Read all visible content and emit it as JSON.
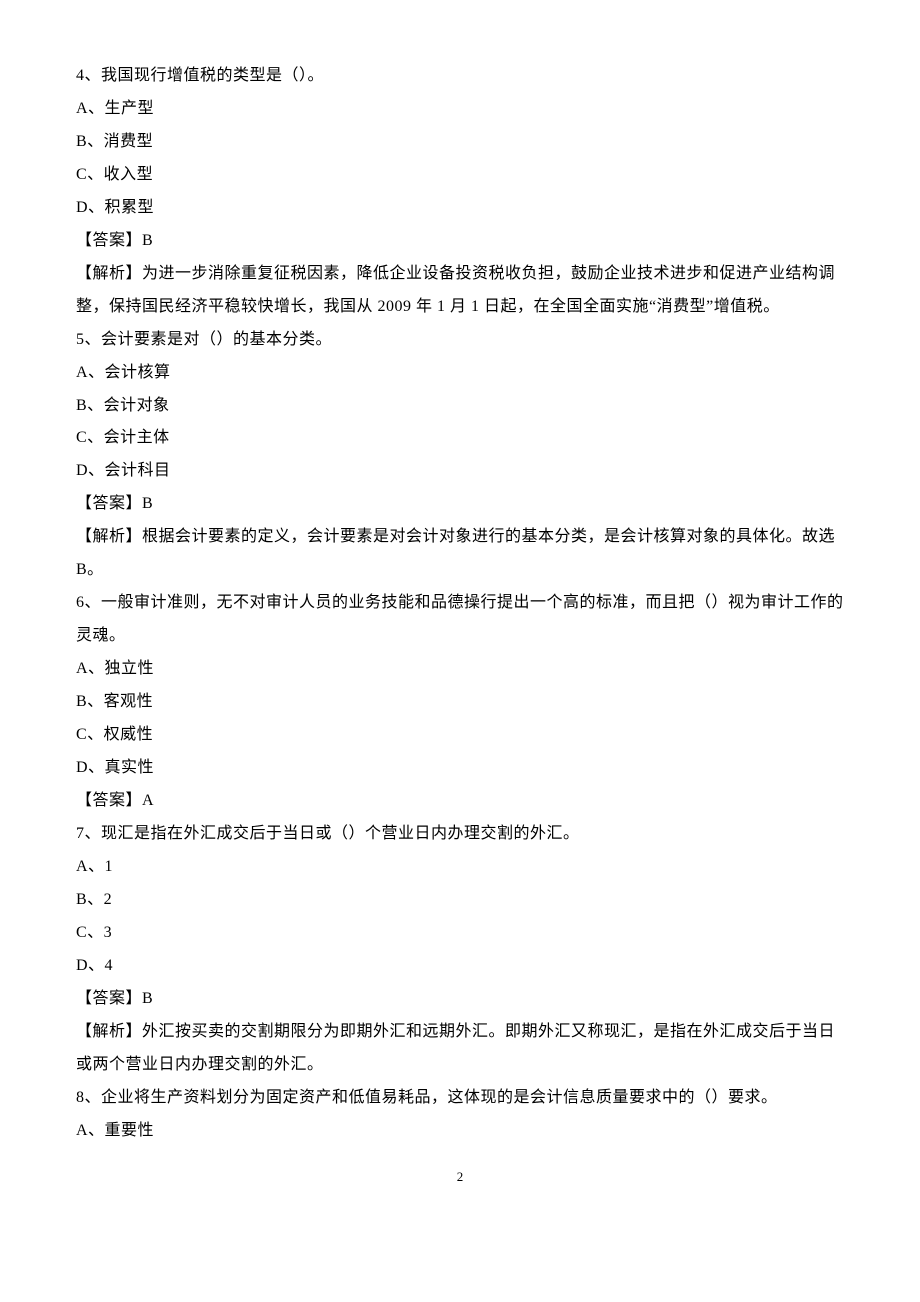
{
  "q4": {
    "stem": "4、我国现行增值税的类型是（）。",
    "a": "A、生产型",
    "b": "B、消费型",
    "c": "C、收入型",
    "d": "D、积累型",
    "answer": "【答案】B",
    "explain": "【解析】为进一步消除重复征税因素，降低企业设备投资税收负担，鼓励企业技术进步和促进产业结构调整，保持国民经济平稳较快增长，我国从 2009 年 1 月 1 日起，在全国全面实施“消费型”增值税。"
  },
  "q5": {
    "stem": "5、会计要素是对（）的基本分类。",
    "a": "A、会计核算",
    "b": "B、会计对象",
    "c": "C、会计主体",
    "d": "D、会计科目",
    "answer": "【答案】B",
    "explain": "【解析】根据会计要素的定义，会计要素是对会计对象进行的基本分类，是会计核算对象的具体化。故选B。"
  },
  "q6": {
    "stem": "6、一般审计准则，无不对审计人员的业务技能和品德操行提出一个高的标准，而且把（）视为审计工作的灵魂。",
    "a": "A、独立性",
    "b": "B、客观性",
    "c": "C、权威性",
    "d": "D、真实性",
    "answer": "【答案】A"
  },
  "q7": {
    "stem": "7、现汇是指在外汇成交后于当日或（）个营业日内办理交割的外汇。",
    "a": "A、1",
    "b": "B、2",
    "c": "C、3",
    "d": "D、4",
    "answer": "【答案】B",
    "explain": "【解析】外汇按买卖的交割期限分为即期外汇和远期外汇。即期外汇又称现汇，是指在外汇成交后于当日或两个营业日内办理交割的外汇。"
  },
  "q8": {
    "stem": "8、企业将生产资料划分为固定资产和低值易耗品，这体现的是会计信息质量要求中的（）要求。",
    "a": "A、重要性"
  },
  "page_number": "2"
}
